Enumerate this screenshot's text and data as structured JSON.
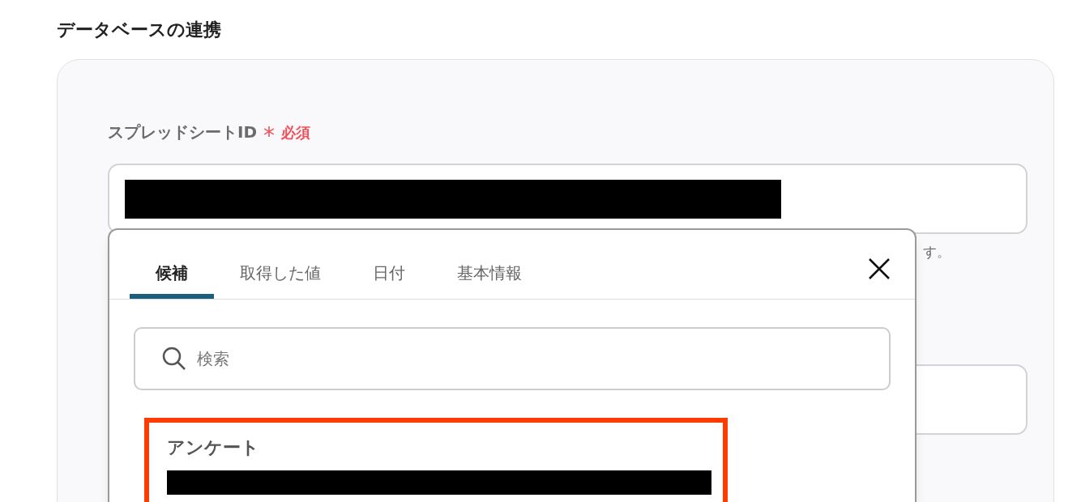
{
  "section_title": "データベースの連携",
  "field": {
    "label": "スプレッドシートID",
    "required_mark": "*",
    "required_text": "必須",
    "hint": "す。"
  },
  "popup": {
    "tabs": [
      {
        "label": "候補",
        "selected": true
      },
      {
        "label": "取得した値",
        "selected": false
      },
      {
        "label": "日付",
        "selected": false
      },
      {
        "label": "基本情報",
        "selected": false
      }
    ],
    "search": {
      "placeholder": "検索"
    },
    "items": [
      {
        "title": "アンケート",
        "highlighted": true
      }
    ]
  }
}
